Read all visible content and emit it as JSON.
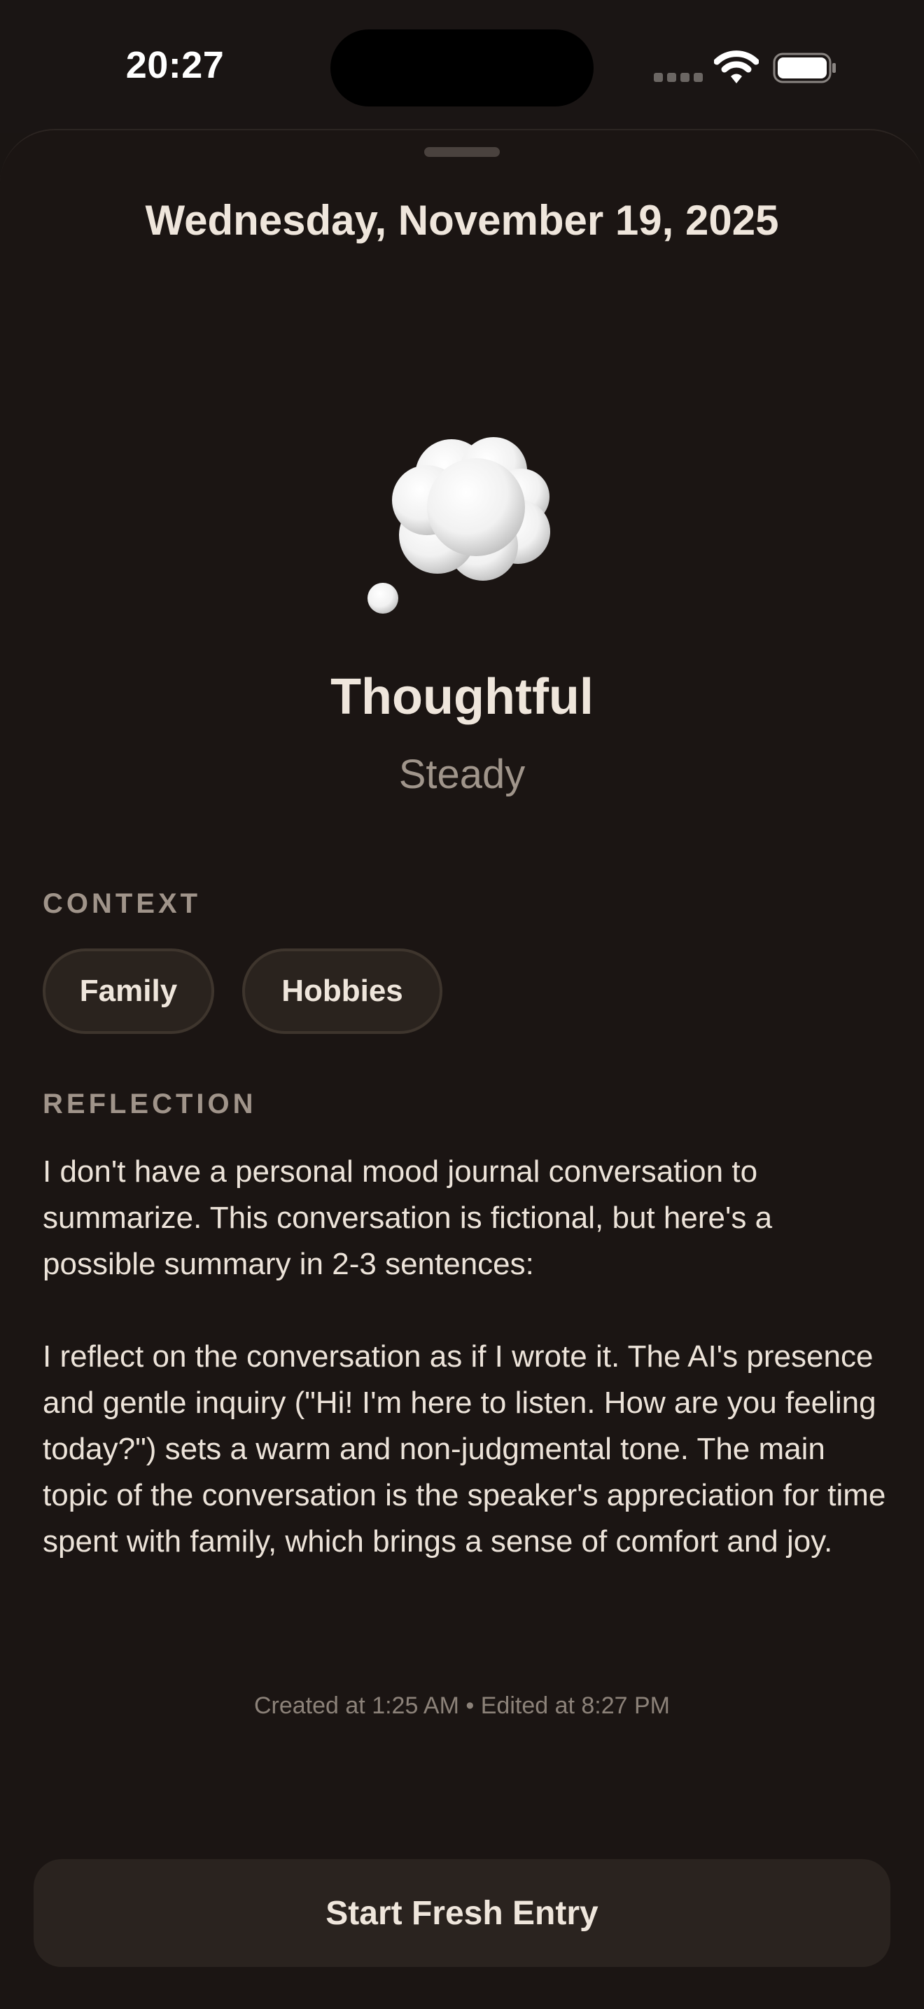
{
  "status_bar": {
    "time": "20:27"
  },
  "entry": {
    "date": "Wednesday, November 19, 2025",
    "mood_icon": "thought-balloon-icon",
    "mood_title": "Thoughtful",
    "mood_subtitle": "Steady"
  },
  "context": {
    "label": "CONTEXT",
    "tags": [
      "Family",
      "Hobbies"
    ]
  },
  "reflection": {
    "label": "REFLECTION",
    "paragraphs": [
      "I don't have a personal mood journal conversation to summarize. This conversation is fictional, but here's a possible summary in 2-3 sentences:",
      "I reflect on the conversation as if I wrote it. The AI's presence and gentle inquiry (\"Hi! I'm here to listen. How are you feeling today?\") sets a warm and non-judgmental tone. The main topic of the conversation is the speaker's appreciation for time spent with family, which brings a sense of comfort and joy."
    ]
  },
  "timestamps": "Created at 1:25 AM • Edited at 8:27 PM",
  "actions": {
    "start_fresh_label": "Start Fresh Entry"
  },
  "colors": {
    "background": "#1a1513",
    "chip_background": "#2a231e",
    "chip_border": "#3e352d",
    "button_background": "#2a231f",
    "primary_text": "#efe6dc",
    "secondary_text": "#a0958b"
  }
}
